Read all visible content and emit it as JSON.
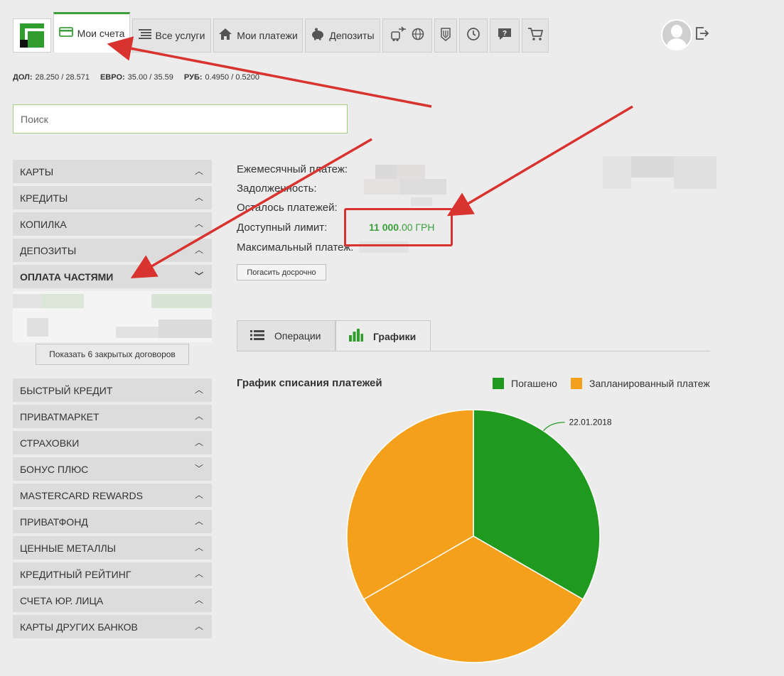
{
  "tabs": [
    {
      "label": "Мои счета",
      "icon": "card-icon"
    },
    {
      "label": "Все услуги",
      "icon": "list-icon"
    },
    {
      "label": "Мои платежи",
      "icon": "house-icon"
    },
    {
      "label": "Депозиты",
      "icon": "piggy-bank-icon"
    }
  ],
  "rates": [
    {
      "name": "ДОЛ:",
      "value": "28.250 / 28.571"
    },
    {
      "name": "ЕВРО:",
      "value": "35.00 / 35.59"
    },
    {
      "name": "РУБ:",
      "value": "0.4950 / 0.5200"
    }
  ],
  "search": {
    "placeholder": "Поиск"
  },
  "sidebar": {
    "top_items": [
      "Карты",
      "Кредиты",
      "Копилка",
      "Депозиты",
      "Оплата частями"
    ],
    "show_closed": "Показать 6 закрытых договоров",
    "bottom_items": [
      "Быстрый кредит",
      "ПриватМаркет",
      "Страховки",
      "Бонус Плюс",
      "MasterCard Rewards",
      "ПриватФонд",
      "Ценные металлы",
      "Кредитный рейтинг",
      "Счета юр. лица",
      "Карты других банков"
    ]
  },
  "info": {
    "monthly_payment_label": "Ежемесячный платеж:",
    "debt_label": "Задолженность:",
    "remaining_label": "Осталось платежей:",
    "available_limit_label": "Доступный лимит:",
    "max_payment_label": "Максимальный платеж:",
    "available_limit_int": "11 000",
    "available_limit_dec": ".00 ГРН",
    "repay_button": "Погасить досрочно"
  },
  "content_tabs": [
    "Операции",
    "Графики"
  ],
  "chart_data": {
    "type": "pie",
    "title": "График списания платежей",
    "legend": [
      {
        "name": "Погашено",
        "color": "#1f9a1f"
      },
      {
        "name": "Запланированный платеж",
        "color": "#f5a01a"
      }
    ],
    "slices": [
      {
        "series": "Погашено",
        "value": 1,
        "label": "22.01.2018",
        "color": "#1f9a1f"
      },
      {
        "series": "Запланированный платеж",
        "value": 1,
        "label": "",
        "color": "#f5a01a"
      },
      {
        "series": "Запланированный платеж",
        "value": 1,
        "label": "",
        "color": "#f5a01a"
      }
    ]
  },
  "colors": {
    "accent": "#3ba03b",
    "annotation": "#d9332f"
  }
}
